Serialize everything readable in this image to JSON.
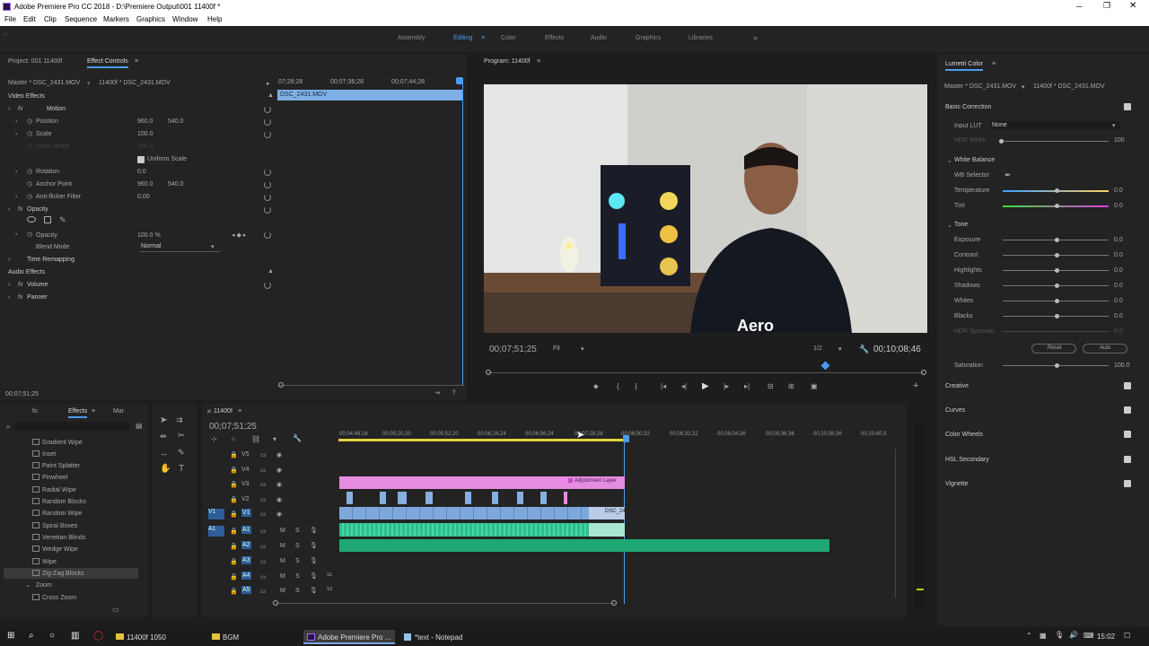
{
  "title": {
    "text": "Adobe Premiere Pro CC 2018 - D:\\Premiere Output\\001 11400f *"
  },
  "menu": [
    "File",
    "Edit",
    "Clip",
    "Sequence",
    "Markers",
    "Graphics",
    "Window",
    "Help"
  ],
  "workspaces": [
    "Assembly",
    "Editing",
    "Color",
    "Effects",
    "Audio",
    "Graphics",
    "Libraries"
  ],
  "effect_controls": {
    "tab_project": "Project: 001 11400f",
    "tab_effect": "Effect Controls",
    "master": "Master * DSC_2431.MOV",
    "sequence": "11400f * DSC_2431.MOV",
    "times": [
      "07;28;28",
      "00;07;36;28",
      "00;07;44;28",
      "00"
    ],
    "clip": "DSC_2431.MOV",
    "video_effects": "Video Effects",
    "motion": "Motion",
    "position": "Position",
    "pos_x": "960.0",
    "pos_y": "540.0",
    "scale": "Scale",
    "scale_v": "100.0",
    "scale_width": "Scale Width",
    "scale_width_v": "100.0",
    "uniform": "Uniform Scale",
    "rotation": "Rotation",
    "rot_v": "0.0",
    "anchor": "Anchor Point",
    "anc_x": "960.0",
    "anc_y": "540.0",
    "antiflicker": "Anti-flicker Filter",
    "af_v": "0.00",
    "opacity_group": "Opacity",
    "opacity": "Opacity",
    "opacity_v": "100.0 %",
    "blend": "Blend Mode",
    "blend_v": "Normal",
    "time_remap": "Time Remapping",
    "audio_effects": "Audio Effects",
    "volume": "Volume",
    "panner": "Panner",
    "timecode": "00;07;51;25"
  },
  "program": {
    "title": "Program: 11400f",
    "timecode": "00;07;51;25",
    "fit": "Fit",
    "res": "1/2",
    "duration": "00;10;08;46",
    "shirt_text": "Aero"
  },
  "lumetri": {
    "title": "Lumetri Color",
    "master": "Master * DSC_2431.MOV",
    "seq": "11400f * DSC_2431.MOV",
    "basic": "Basic Correction",
    "input_lut": "Input LUT",
    "lut_v": "None",
    "hdr": "HDR White",
    "hdr_v": "100",
    "wb": "White Balance",
    "wb_sel": "WB Selector",
    "temperature": "Temperature",
    "tint": "Tint",
    "tone": "Tone",
    "tone_items": [
      "Exposure",
      "Contrast",
      "Highlights",
      "Shadows",
      "Whites",
      "Blacks"
    ],
    "hdr_spec": "HDR Specular",
    "zero": "0.0",
    "reset": "Reset",
    "auto": "Auto",
    "saturation": "Saturation",
    "sat_v": "100.0",
    "sections": [
      "Creative",
      "Curves",
      "Color Wheels",
      "HSL Secondary",
      "Vignette"
    ]
  },
  "effects_panel": {
    "tabs": [
      "fo",
      "Effects",
      "Mar"
    ],
    "items": [
      "Gradient Wipe",
      "Inset",
      "Paint Splatter",
      "Pinwheel",
      "Radial Wipe",
      "Random Blocks",
      "Random Wipe",
      "Spiral Boxes",
      "Venetian Blinds",
      "Wedge Wipe",
      "Wipe",
      "Zig-Zag Blocks",
      "Zoom",
      "Cross Zoom"
    ]
  },
  "timeline": {
    "tab": "11400f",
    "timecode": "00;07;51;25",
    "ruler": [
      "00;04;48;16",
      "00;05;20;20",
      "00;05;52;20",
      "00;06;24;24",
      "00;06;56;24",
      "00;07;28;28",
      "00;08;00;32",
      "00;08;32;32",
      "00;09;04;36",
      "00;09;36;36",
      "00;10;08;36",
      "00;10;40;3"
    ],
    "tracks": [
      "V5",
      "V4",
      "V3",
      "V2",
      "V1",
      "A1",
      "A2",
      "A3",
      "A4",
      "A5"
    ],
    "adj_label": "Adjustment Layer",
    "clip_label": "DSC_24",
    "vol_labels": [
      "S1",
      "S3"
    ]
  },
  "taskbar": {
    "apps": [
      "11400f 1050",
      "BGM",
      "Adobe Premiere Pro ...",
      "*text - Notepad"
    ],
    "clock": "15:02"
  }
}
